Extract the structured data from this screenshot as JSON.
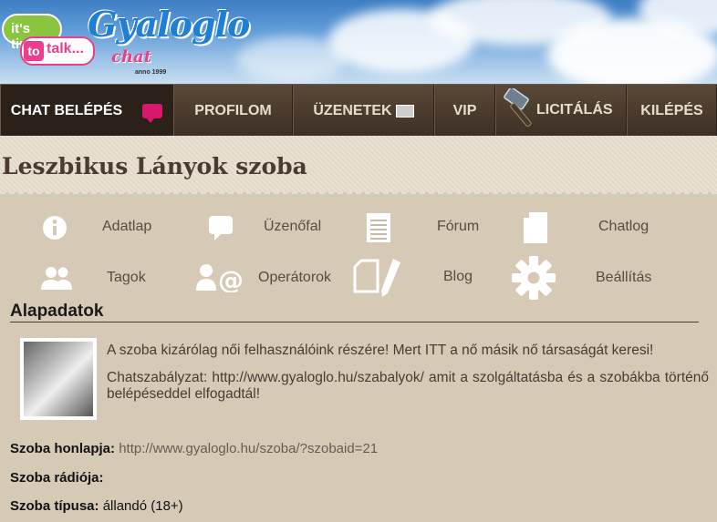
{
  "brand": {
    "bubble_top": "it's time",
    "bubble_to": "to",
    "bubble_talk": "talk...",
    "logo_main": "Gyaloglo",
    "logo_chat": "chat",
    "logo_anno": "anno 1999"
  },
  "nav": {
    "items": [
      {
        "label": "CHAT BELÉPÉS",
        "icon": "chat-bubble-icon",
        "active": true
      },
      {
        "label": "PROFILOM"
      },
      {
        "label": "ÜZENETEK",
        "icon": "envelope-icon"
      },
      {
        "label": "VIP"
      },
      {
        "label": "LICITÁLÁS",
        "icon": "hammer-icon"
      },
      {
        "label": "KILÉPÉS"
      }
    ]
  },
  "room": {
    "title": "Leszbikus Lányok szoba"
  },
  "menu": {
    "items": [
      {
        "label": "Adatlap",
        "icon": "info-icon"
      },
      {
        "label": "Üzenőfal",
        "icon": "speech-bubble-icon"
      },
      {
        "label": "Fórum",
        "icon": "document-icon"
      },
      {
        "label": "Chatlog",
        "icon": "file-icon"
      },
      {
        "label": "Tagok",
        "icon": "users-icon"
      },
      {
        "label": "Operátorok",
        "icon": "operator-at-icon"
      },
      {
        "label": "Blog",
        "icon": "pencil-paper-icon"
      },
      {
        "label": "Beállítás",
        "icon": "gear-icon"
      }
    ]
  },
  "section": {
    "title": "Alapadatok",
    "desc1": "A szoba kizárólag női felhasználóink részére! Mert ITT a nő másik nő társaságát keresi!",
    "desc2": "Chatszabályzat: http://www.gyaloglo.hu/szabalyok/ amit a szolgáltatásba és a szobákba történő belépéseddel elfogadtál!"
  },
  "details": {
    "homepage_label": "Szoba honlapja:",
    "homepage_value": "http://www.gyaloglo.hu/szoba/?szobaid=21",
    "radio_label": "Szoba rádiója:",
    "radio_value": "",
    "type_label": "Szoba típusa:",
    "type_value": "állandó (18+)"
  },
  "colors": {
    "nav_bg": "#3e3026",
    "page_bg": "#d6cab7",
    "accent_pink": "#d8186e",
    "logo_blue": "#1f7fd4"
  }
}
